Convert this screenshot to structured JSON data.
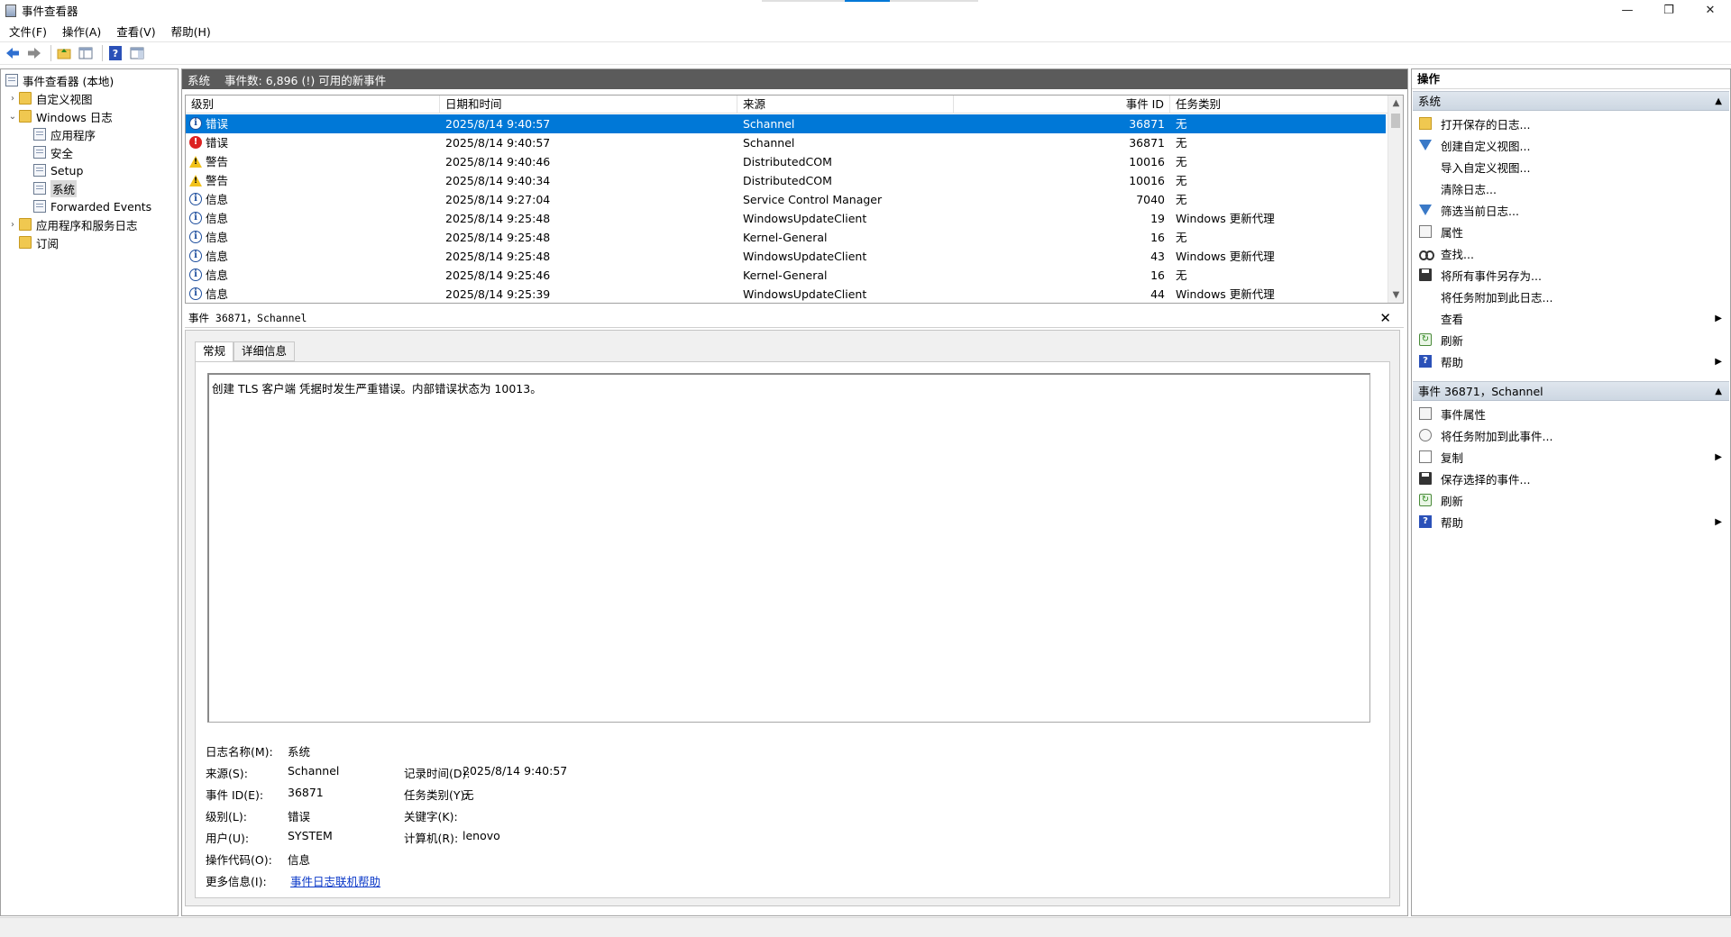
{
  "window": {
    "title": "事件查看器",
    "minimize_glyph": "—",
    "maximize_glyph": "❐",
    "close_glyph": "✕"
  },
  "menu": [
    "文件(F)",
    "操作(A)",
    "查看(V)",
    "帮助(H)"
  ],
  "toolbar": {
    "icons": [
      "back-arrow-icon",
      "forward-arrow-icon",
      "up-folder-icon",
      "show-hide-tree-icon",
      "help-icon",
      "show-hide-action-pane-icon"
    ]
  },
  "tree": {
    "root": "事件查看器 (本地)",
    "custom_views": "自定义视图",
    "windows_logs": "Windows 日志",
    "application": "应用程序",
    "security": "安全",
    "setup": "Setup",
    "system": "系统",
    "forwarded": "Forwarded Events",
    "app_service_logs": "应用程序和服务日志",
    "subscriptions": "订阅"
  },
  "center": {
    "log_name": "系统",
    "event_count": "事件数: 6,896 (!) 可用的新事件",
    "columns": [
      "级别",
      "日期和时间",
      "来源",
      "事件 ID",
      "任务类别"
    ],
    "rows": [
      {
        "level": "错误",
        "icon": "info-icon",
        "datetime": "2025/8/14 9:40:57",
        "source": "Schannel",
        "event_id": "36871",
        "task": "无",
        "selected": true
      },
      {
        "level": "错误",
        "icon": "error-icon",
        "datetime": "2025/8/14 9:40:57",
        "source": "Schannel",
        "event_id": "36871",
        "task": "无"
      },
      {
        "level": "警告",
        "icon": "warning-icon",
        "datetime": "2025/8/14 9:40:46",
        "source": "DistributedCOM",
        "event_id": "10016",
        "task": "无"
      },
      {
        "level": "警告",
        "icon": "warning-icon",
        "datetime": "2025/8/14 9:40:34",
        "source": "DistributedCOM",
        "event_id": "10016",
        "task": "无"
      },
      {
        "level": "信息",
        "icon": "info-icon",
        "datetime": "2025/8/14 9:27:04",
        "source": "Service Control Manager",
        "event_id": "7040",
        "task": "无"
      },
      {
        "level": "信息",
        "icon": "info-icon",
        "datetime": "2025/8/14 9:25:48",
        "source": "WindowsUpdateClient",
        "event_id": "19",
        "task": "Windows 更新代理"
      },
      {
        "level": "信息",
        "icon": "info-icon",
        "datetime": "2025/8/14 9:25:48",
        "source": "Kernel-General",
        "event_id": "16",
        "task": "无"
      },
      {
        "level": "信息",
        "icon": "info-icon",
        "datetime": "2025/8/14 9:25:48",
        "source": "WindowsUpdateClient",
        "event_id": "43",
        "task": "Windows 更新代理"
      },
      {
        "level": "信息",
        "icon": "info-icon",
        "datetime": "2025/8/14 9:25:46",
        "source": "Kernel-General",
        "event_id": "16",
        "task": "无"
      },
      {
        "level": "信息",
        "icon": "info-icon",
        "datetime": "2025/8/14 9:25:39",
        "source": "WindowsUpdateClient",
        "event_id": "44",
        "task": "Windows 更新代理"
      }
    ]
  },
  "detail": {
    "header": "事件 36871，Schannel",
    "close": "✕",
    "tabs": [
      "常规",
      "详细信息"
    ],
    "description": "创建 TLS 客户端 凭据时发生严重错误。内部错误状态为 10013。",
    "props": {
      "log_name_label": "日志名称(M):",
      "log_name": "系统",
      "source_label": "来源(S):",
      "source": "Schannel",
      "logged_label": "记录时间(D):",
      "logged": "2025/8/14 9:40:57",
      "event_id_label": "事件 ID(E):",
      "event_id": "36871",
      "task_label": "任务类别(Y):",
      "task": "无",
      "level_label": "级别(L):",
      "level": "错误",
      "keywords_label": "关键字(K):",
      "keywords": "",
      "user_label": "用户(U):",
      "user": "SYSTEM",
      "computer_label": "计算机(R):",
      "computer": "lenovo",
      "opcode_label": "操作代码(O):",
      "opcode": "信息",
      "more_info_label": "更多信息(I):",
      "more_info_link": "事件日志联机帮助"
    }
  },
  "actions": {
    "title": "操作",
    "group1": "系统",
    "group1_items": [
      {
        "label": "打开保存的日志...",
        "icon": "open-log-icon"
      },
      {
        "label": "创建自定义视图...",
        "icon": "filter-icon"
      },
      {
        "label": "导入自定义视图...",
        "icon": ""
      },
      {
        "label": "清除日志...",
        "icon": ""
      },
      {
        "label": "筛选当前日志...",
        "icon": "filter-icon"
      },
      {
        "label": "属性",
        "icon": "properties-icon"
      },
      {
        "label": "查找...",
        "icon": "find-icon"
      },
      {
        "label": "将所有事件另存为...",
        "icon": "save-icon"
      },
      {
        "label": "将任务附加到此日志...",
        "icon": ""
      },
      {
        "label": "查看",
        "icon": "",
        "submenu": true
      },
      {
        "label": "刷新",
        "icon": "refresh-icon"
      },
      {
        "label": "帮助",
        "icon": "help-icon",
        "submenu": true
      }
    ],
    "group2": "事件 36871，Schannel",
    "group2_items": [
      {
        "label": "事件属性",
        "icon": "properties-icon"
      },
      {
        "label": "将任务附加到此事件...",
        "icon": "task-icon"
      },
      {
        "label": "复制",
        "icon": "copy-icon",
        "submenu": true
      },
      {
        "label": "保存选择的事件...",
        "icon": "save-icon"
      },
      {
        "label": "刷新",
        "icon": "refresh-icon"
      },
      {
        "label": "帮助",
        "icon": "help-icon",
        "submenu": true
      }
    ],
    "submenu_glyph": "▶",
    "collapse_glyph": "▲"
  }
}
